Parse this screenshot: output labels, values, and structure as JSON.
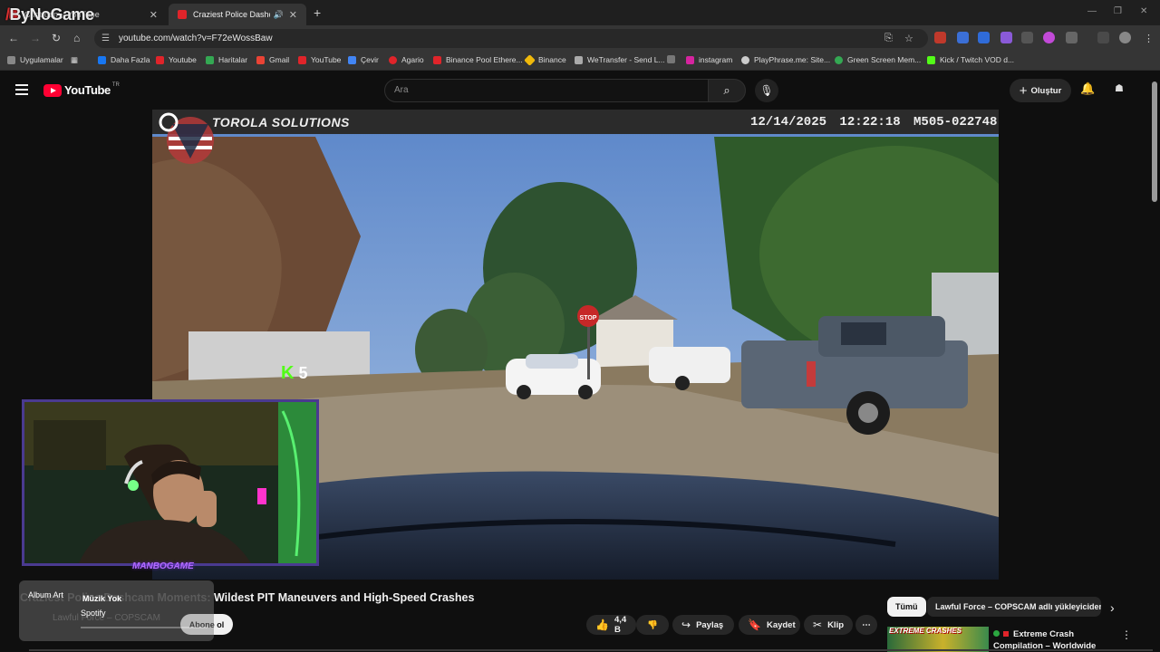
{
  "browser": {
    "overlay_brand": "ByNoGame",
    "tabs": [
      {
        "title": "Chatroom - YouTube",
        "active": false
      },
      {
        "title": "Craziest Police Dashcam Mo",
        "active": true
      }
    ],
    "url": "youtube.com/watch?v=F72eWossBaw",
    "bookmarks": [
      {
        "label": "Uygulamalar",
        "color": "#888888"
      },
      {
        "label": "Daha Fazla",
        "color": "#1877f2"
      },
      {
        "label": "Youtube",
        "color": "#e0242a"
      },
      {
        "label": "Haritalar",
        "color": "#34a853"
      },
      {
        "label": "Gmail",
        "color": "#ea4335"
      },
      {
        "label": "YouTube",
        "color": "#e0242a"
      },
      {
        "label": "Çevir",
        "color": "#4285f4"
      },
      {
        "label": "Agario",
        "color": "#e0242a"
      },
      {
        "label": "Binance Pool Ethere...",
        "color": "#e0242a"
      },
      {
        "label": "Binance",
        "color": "#f0b90b"
      },
      {
        "label": "WeTransfer - Send L...",
        "color": "#aaaaaa"
      },
      {
        "label": "instagram",
        "color": "#d6249f"
      },
      {
        "label": "PlayPhrase.me: Site...",
        "color": "#cccccc"
      },
      {
        "label": "Green Screen Mem...",
        "color": "#34a853"
      },
      {
        "label": "Kick / Twitch VOD d...",
        "color": "#53fc18"
      }
    ]
  },
  "yt_header": {
    "logo": "YouTube",
    "logo_country": "TR",
    "search_placeholder": "Ara",
    "create_label": "Oluştur"
  },
  "video": {
    "overlay_brand": "TOROLA SOLUTIONS",
    "stamp": "12/14/2025  12:22:18  M505-022748",
    "kick_count": "5"
  },
  "webcam": {
    "tag": "MANBOGAME"
  },
  "spotify": {
    "art_label": "Album Art",
    "song": "Müzik Yok",
    "source": "Spotify",
    "progress": 0
  },
  "watch": {
    "title_hidden": "Craziest Police Dashcam Moments: ",
    "title_visible": "Wildest PIT Maneuvers and High-Speed Crashes",
    "channel": "Lawful Force – COPSCAM",
    "subscribe_label": "Abone ol",
    "like_count": "4,4 B",
    "share_label": "Paylaş",
    "save_label": "Kaydet",
    "clip_label": "Klip"
  },
  "sidebar": {
    "chips": [
      "Tümü",
      "Lawful Force – COPSCAM adlı yükleyiciden"
    ],
    "recommendation": {
      "thumb_text": "EXTREME CRASHES",
      "title": "Extreme Crash Compilation – Worldwide"
    }
  }
}
